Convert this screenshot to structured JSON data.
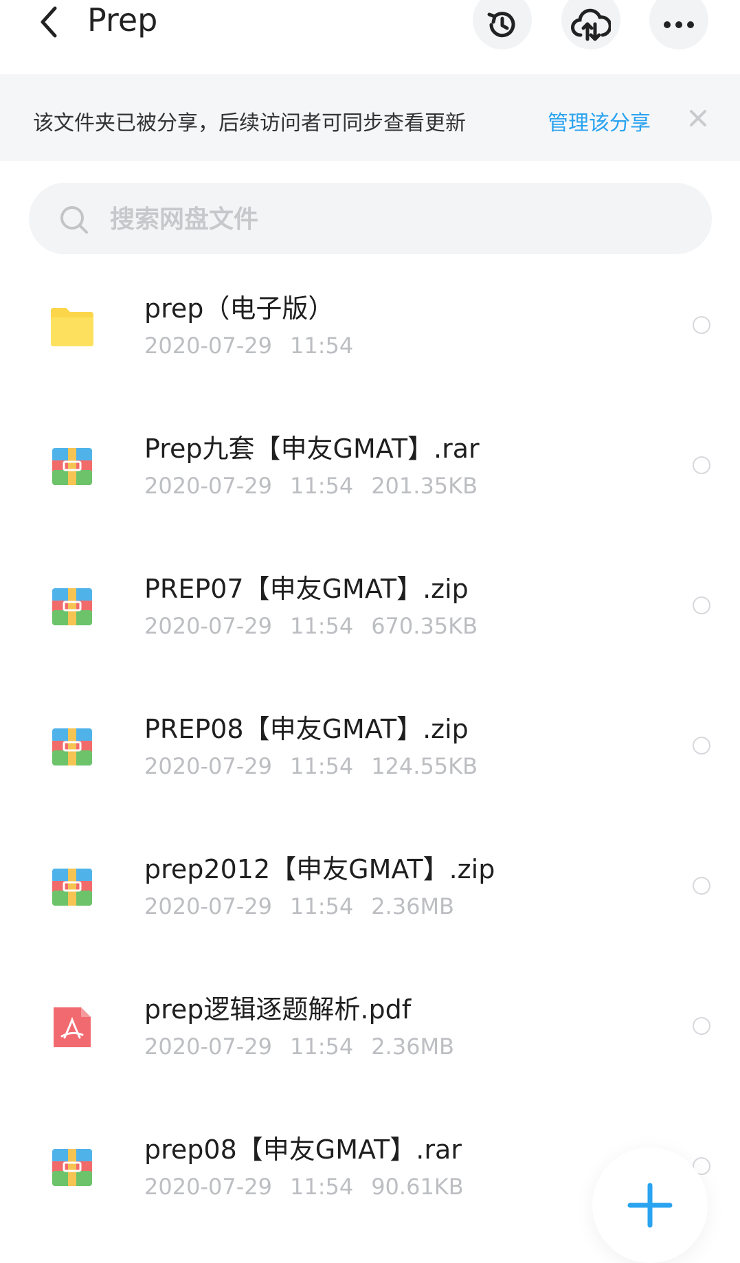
{
  "header": {
    "title": "Prep"
  },
  "banner": {
    "text": "该文件夹已被分享，后续访问者可同步查看更新",
    "link": "管理该分享"
  },
  "search": {
    "placeholder": "搜索网盘文件"
  },
  "files": [
    {
      "name": "prep（电子版）",
      "date": "2020-07-29",
      "time": "11:54",
      "size": "",
      "icon": "folder-icon"
    },
    {
      "name": "Prep九套【申友GMAT】.rar",
      "date": "2020-07-29",
      "time": "11:54",
      "size": "201.35KB",
      "icon": "archive-icon"
    },
    {
      "name": "PREP07【申友GMAT】.zip",
      "date": "2020-07-29",
      "time": "11:54",
      "size": "670.35KB",
      "icon": "archive-icon"
    },
    {
      "name": "PREP08【申友GMAT】.zip",
      "date": "2020-07-29",
      "time": "11:54",
      "size": "124.55KB",
      "icon": "archive-icon"
    },
    {
      "name": "prep2012【申友GMAT】.zip",
      "date": "2020-07-29",
      "time": "11:54",
      "size": "2.36MB",
      "icon": "archive-icon"
    },
    {
      "name": "prep逻辑逐题解析.pdf",
      "date": "2020-07-29",
      "time": "11:54",
      "size": "2.36MB",
      "icon": "pdf-icon"
    },
    {
      "name": "prep08【申友GMAT】.rar",
      "date": "2020-07-29",
      "time": "11:54",
      "size": "90.61KB",
      "icon": "archive-icon"
    }
  ],
  "colors": {
    "accent": "#2aa3f0",
    "folder": "#fcd64a",
    "pdf": "#f16a6f"
  }
}
